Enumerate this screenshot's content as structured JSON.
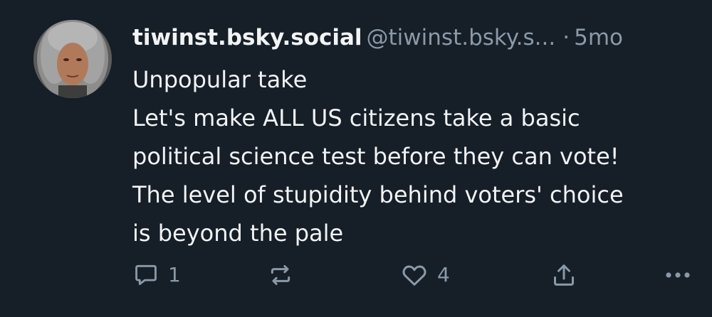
{
  "post": {
    "display_name": "tiwinst.bsky.social",
    "handle": "@tiwinst.bsky.s...",
    "separator": "·",
    "time": "5mo",
    "text": "Unpopular take\nLet's make ALL US citizens take a basic\npolitical science test before they can vote!\nThe level of stupidity behind voters' choice\nis beyond the pale",
    "reply_count": "1",
    "like_count": "4"
  },
  "icons": {
    "reply": "comment-icon",
    "repost": "repost-icon",
    "like": "heart-icon",
    "share": "share-icon",
    "more": "more-icon"
  },
  "colors": {
    "background": "#161e27",
    "text": "#f1f3f5",
    "muted": "#8a99a8"
  }
}
